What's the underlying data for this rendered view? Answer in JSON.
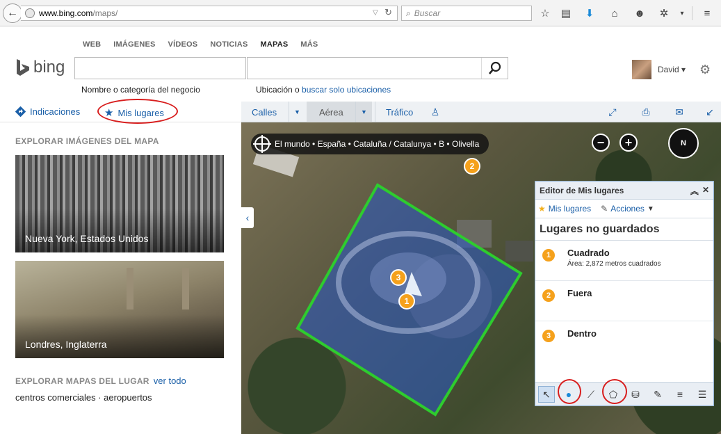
{
  "browser": {
    "url_host": "www.bing.com",
    "url_path": "/maps/",
    "search_placeholder": "Buscar"
  },
  "nav": {
    "items": [
      "WEB",
      "IMÁGENES",
      "VÍDEOS",
      "NOTICIAS",
      "MAPAS",
      "MÁS"
    ],
    "active_index": 4
  },
  "logo": {
    "text": "bing"
  },
  "search": {
    "business_hint": "Nombre o categoría del negocio",
    "location_hint_prefix": "Ubicación o",
    "location_hint_link": "buscar solo ubicaciones"
  },
  "user": {
    "name": "David ▾"
  },
  "left_tabs": {
    "directions": "Indicaciones",
    "my_places": "Mis lugares"
  },
  "explore_images": {
    "title": "EXPLORAR IMÁGENES DEL MAPA",
    "items": [
      {
        "caption": "Nueva York, Estados Unidos"
      },
      {
        "caption": "Londres, Inglaterra"
      }
    ]
  },
  "explore_maps": {
    "title": "EXPLORAR MAPAS DEL LUGAR",
    "see_all": "ver todo",
    "links": "centros comerciales · aeropuertos"
  },
  "map_toolbar": {
    "streets": "Calles",
    "aerial": "Aérea",
    "traffic": "Tráfico"
  },
  "map": {
    "breadcrumb": "El mundo • España • Cataluña / Catalunya • B • Olivella",
    "zoom_out": "−",
    "zoom_in": "+",
    "compass": "N",
    "markers": [
      "2",
      "3",
      "1"
    ]
  },
  "editor": {
    "title": "Editor de Mis lugares",
    "menu_my_places": "Mis lugares",
    "menu_actions": "Acciones",
    "section_title": "Lugares no guardados",
    "places": [
      {
        "num": "1",
        "name": "Cuadrado",
        "detail": "Área: 2,872 metros cuadrados"
      },
      {
        "num": "2",
        "name": "Fuera",
        "detail": ""
      },
      {
        "num": "3",
        "name": "Dentro",
        "detail": ""
      }
    ]
  },
  "colors": {
    "link": "#1a5fa8",
    "marker": "#f5a11c",
    "polygon_stroke": "#2ecc2e",
    "highlight_ring": "#d81e1e"
  }
}
